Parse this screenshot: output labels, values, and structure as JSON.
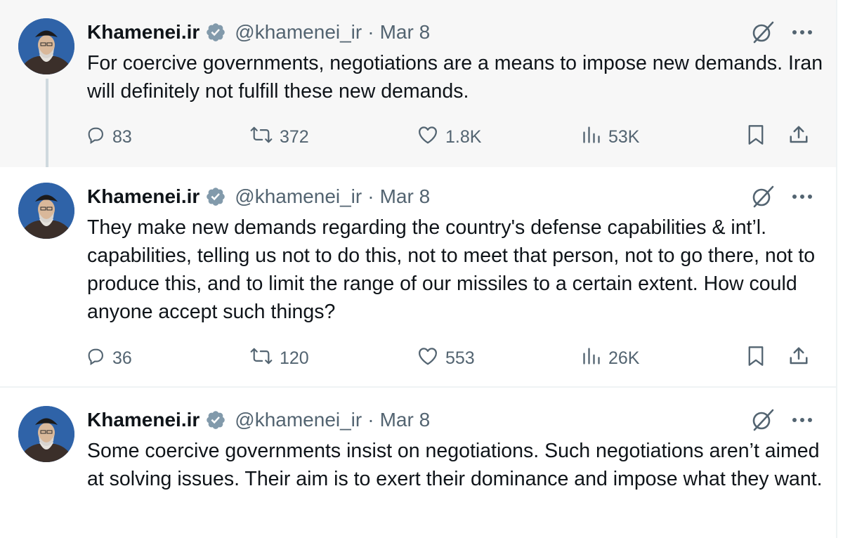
{
  "tweets": [
    {
      "author": {
        "name": "Khamenei.ir",
        "handle": "@khamenei_ir"
      },
      "date": "Mar 8",
      "separator": "·",
      "text": "For coercive governments, negotiations are a means to impose new demands. Iran will definitely not fulfill these new demands.",
      "stats": {
        "replies": "83",
        "reposts": "372",
        "likes": "1.8K",
        "views": "53K"
      }
    },
    {
      "author": {
        "name": "Khamenei.ir",
        "handle": "@khamenei_ir"
      },
      "date": "Mar 8",
      "separator": "·",
      "text": "They make new demands regarding the country's defense capabilities & int’l. capabilities, telling us not to do this, not to meet that person, not to go there, not to produce this, and to limit the range of our missiles to a certain extent. How could anyone accept such things?",
      "stats": {
        "replies": "36",
        "reposts": "120",
        "likes": "553",
        "views": "26K"
      }
    },
    {
      "author": {
        "name": "Khamenei.ir",
        "handle": "@khamenei_ir"
      },
      "date": "Mar 8",
      "separator": "·",
      "text": "Some coercive governments insist on negotiations. Such negotiations aren’t aimed at solving issues. Their aim is to exert their dominance and impose what they want."
    }
  ],
  "icons": {
    "verified": "verified-badge-icon",
    "grok": "grok-icon",
    "more": "more-options-icon",
    "reply": "reply-icon",
    "repost": "repost-icon",
    "like": "heart-icon",
    "views": "views-icon",
    "bookmark": "bookmark-icon",
    "share": "share-icon"
  },
  "colors": {
    "text": "#0f1419",
    "secondary": "#536471",
    "thread_line": "#cfd9de",
    "highlight_background": "#f7f7f7",
    "verified_badge": "#829aab"
  }
}
